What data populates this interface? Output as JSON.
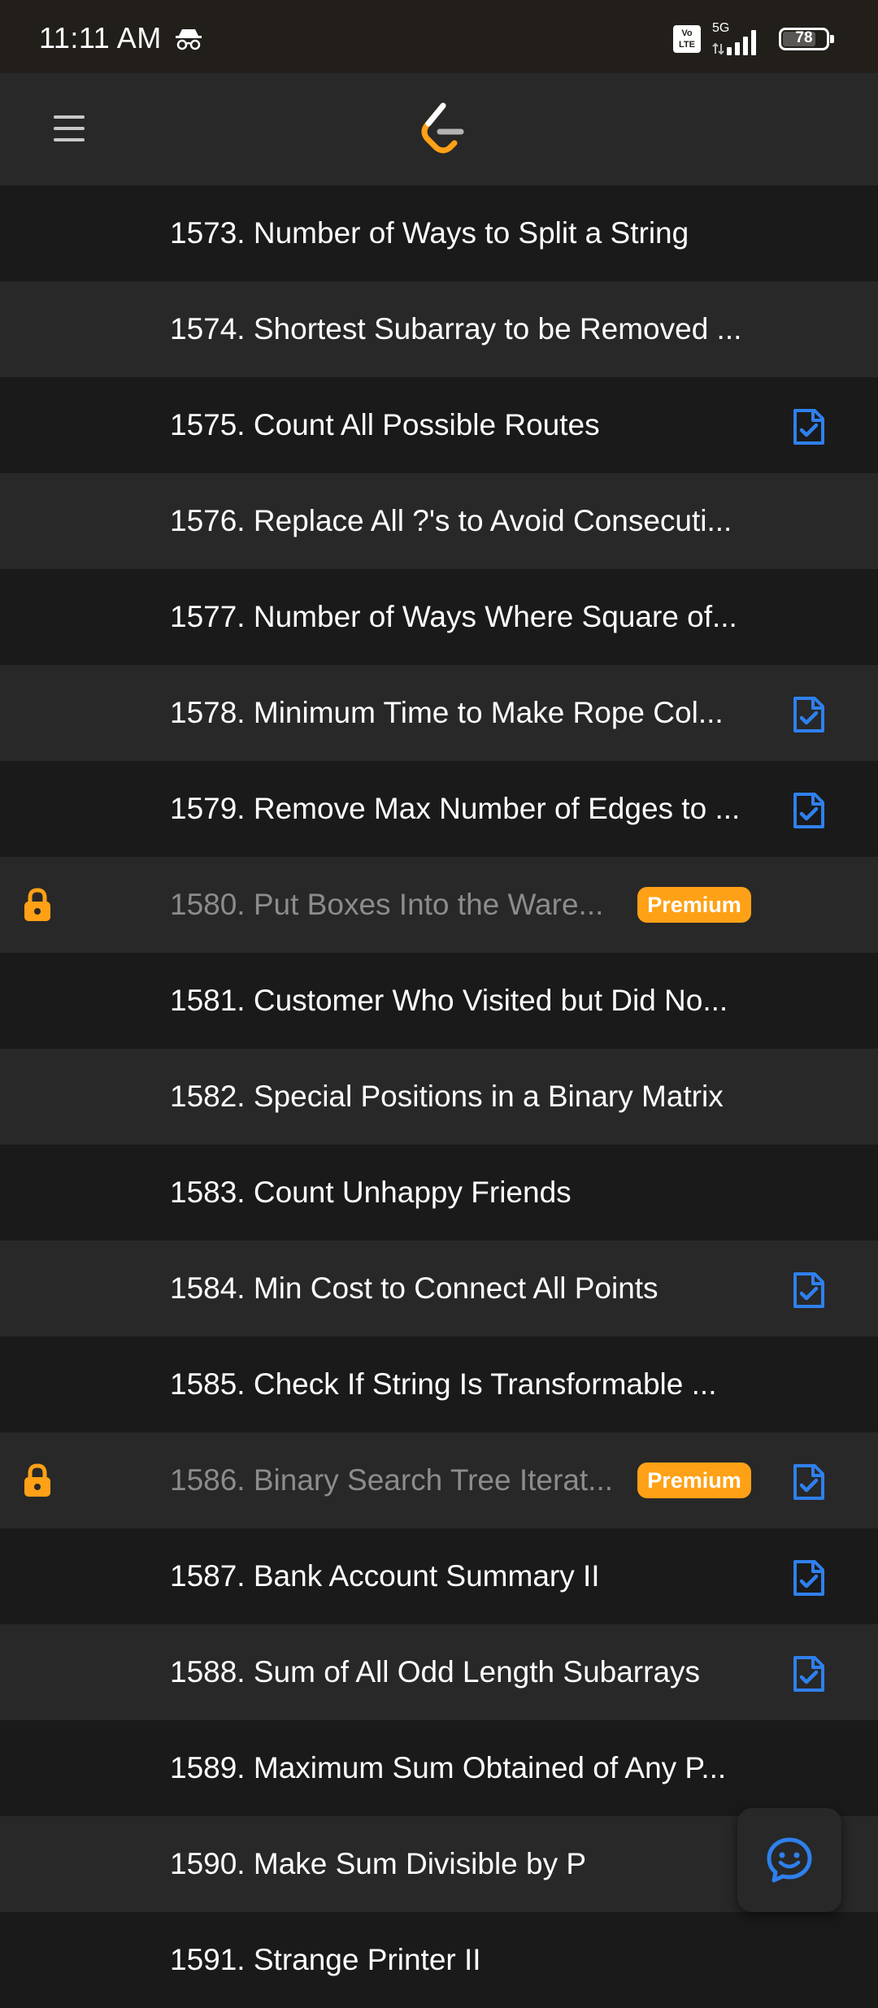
{
  "status_bar": {
    "time": "11:11 AM",
    "volte_label": "Vo LTE",
    "network": "5G",
    "battery": "78",
    "battery_level": 0.78,
    "icons": [
      "incognito-icon",
      "volte-icon",
      "signal-icon",
      "battery-icon"
    ]
  },
  "app_bar": {
    "menu_icon": "menu-icon",
    "logo": "leetcode-logo-icon"
  },
  "colors": {
    "premium": "#ffa116",
    "solved": "#2f80ed",
    "locked_text": "#8c8c8c",
    "row_dark": "#1a1a1a",
    "row_light": "#282828"
  },
  "problems": [
    {
      "title": "1573. Number of Ways to Split a String"
    },
    {
      "title": "1574. Shortest Subarray to be Removed ..."
    },
    {
      "title": "1575. Count All Possible Routes"
    },
    {
      "title": "1576. Replace All ?'s to Avoid Consecuti..."
    },
    {
      "title": "1577. Number of Ways Where Square of..."
    },
    {
      "title": "1578. Minimum Time to Make Rope Col..."
    },
    {
      "title": "1579. Remove Max Number of Edges to ..."
    },
    {
      "title": "1580. Put Boxes Into the Ware...",
      "badge": "Premium"
    },
    {
      "title": "1581. Customer Who Visited but Did No..."
    },
    {
      "title": "1582. Special Positions in a Binary Matrix"
    },
    {
      "title": "1583. Count Unhappy Friends"
    },
    {
      "title": "1584. Min Cost to Connect All Points"
    },
    {
      "title": "1585. Check If String Is Transformable ..."
    },
    {
      "title": "1586. Binary Search Tree Iterat...",
      "badge": "Premium"
    },
    {
      "title": "1587. Bank Account Summary II"
    },
    {
      "title": "1588. Sum of All Odd Length Subarrays"
    },
    {
      "title": "1589. Maximum Sum Obtained of Any P..."
    },
    {
      "title": "1590. Make Sum Divisible by P"
    },
    {
      "title": "1591. Strange Printer II"
    }
  ],
  "fab": {
    "icon": "chat-smile-icon"
  }
}
